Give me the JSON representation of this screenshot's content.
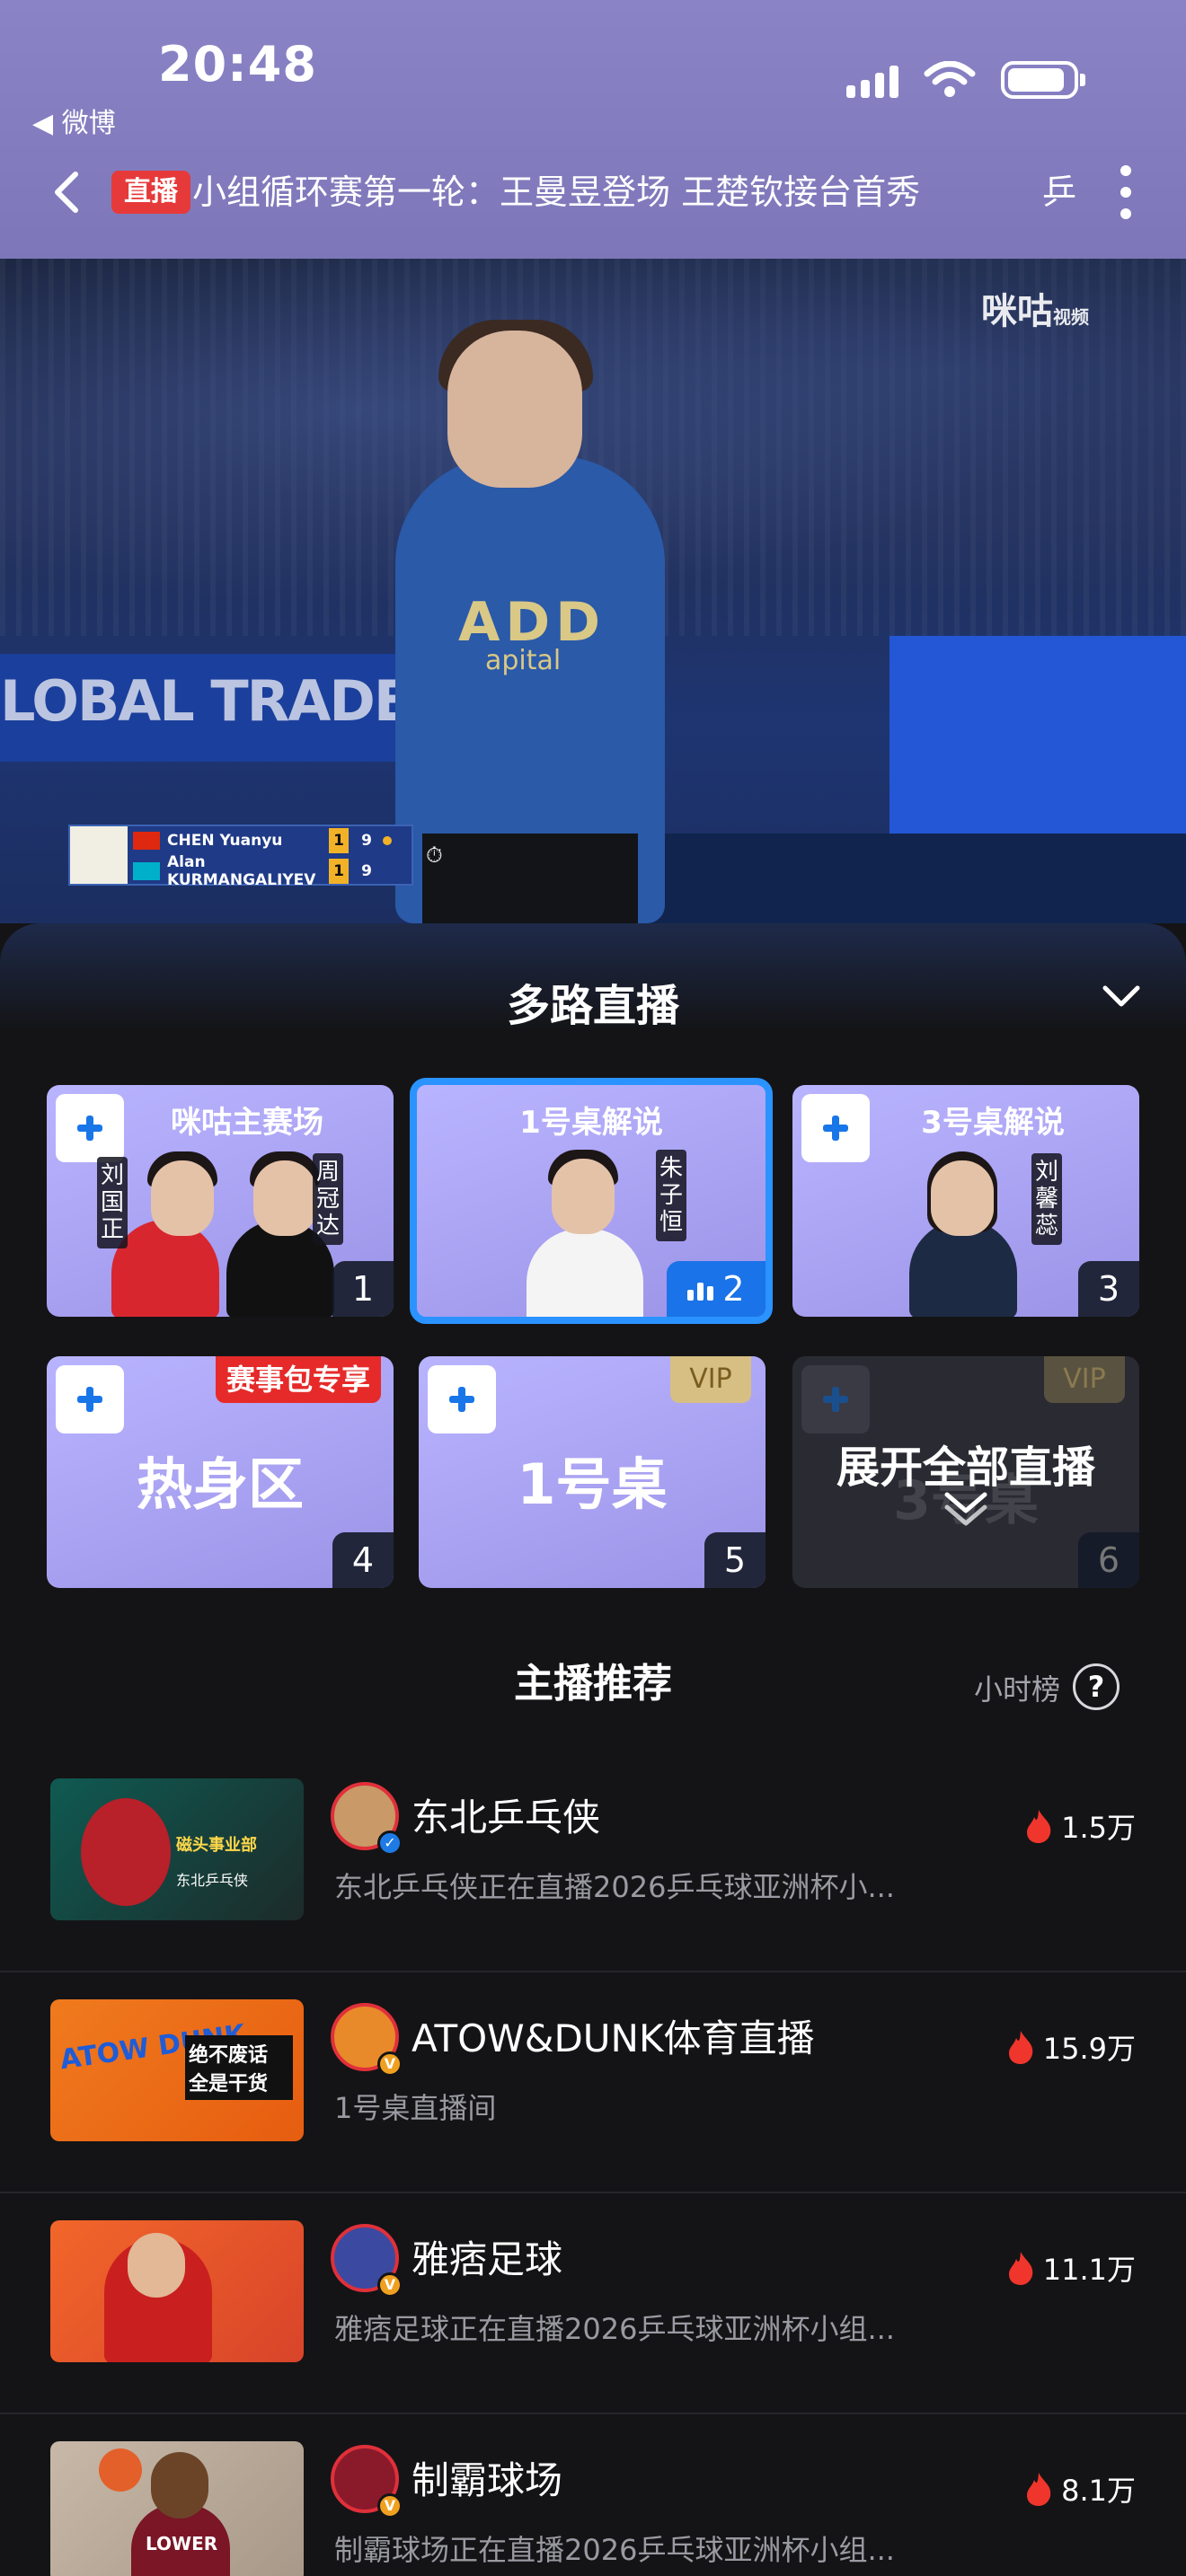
{
  "status_bar": {
    "time": "20:48",
    "back_app": "◀ 微博"
  },
  "nav": {
    "live_tag": "直播",
    "title": "小组循环赛第一轮：王曼昱登场 王楚钦接台首秀",
    "title_overflow": "乒"
  },
  "video": {
    "watermark": "咪咕",
    "watermark_sub": "视频",
    "banner_text": "LOBAL TRADE",
    "jersey_text": "ADD",
    "jersey_sub": "apital",
    "scoreboard": {
      "players": [
        {
          "name": "CHEN Yuanyu",
          "set": "1",
          "points": "9",
          "serving": true
        },
        {
          "name": "Alan KURMANGALIYEV",
          "set": "1",
          "points": "9",
          "serving": false
        }
      ],
      "timer_icon": "⏱"
    }
  },
  "multi_live": {
    "title": "多路直播",
    "cards": [
      {
        "title": "咪咕主赛场",
        "number": "1",
        "names": [
          "刘国正",
          "周冠达"
        ],
        "active": false
      },
      {
        "title": "1号桌解说",
        "number": "2",
        "names": [
          "朱子恒"
        ],
        "active": true
      },
      {
        "title": "3号桌解说",
        "number": "3",
        "names": [
          "刘馨蕊"
        ],
        "active": false
      },
      {
        "big_label": "热身区",
        "number": "4",
        "badge": "赛事包专享"
      },
      {
        "big_label": "1号桌",
        "number": "5",
        "badge": "VIP"
      },
      {
        "ghost_label": "3号桌",
        "number": "6",
        "badge": "VIP",
        "overlay": "展开全部直播"
      }
    ]
  },
  "recommend": {
    "title": "主播推荐",
    "rank_label": "小时榜",
    "help": "?",
    "items": [
      {
        "name": "东北乒乓侠",
        "desc": "东北乒乓侠正在直播2026乒乓球亚洲杯小...",
        "heat": "1.5万",
        "thumb_text": "磁头事业部",
        "thumb_sub": "东北乒乓侠",
        "badge": "✓"
      },
      {
        "name": "ATOW&DUNK体育直播",
        "desc": "1号桌直播间",
        "heat": "15.9万",
        "thumb_text": "ATOW DUNK",
        "thumb_sub": "绝不废话 全是干货",
        "badge": "V"
      },
      {
        "name": "雅痞足球",
        "desc": "雅痞足球正在直播2026乒乓球亚洲杯小组...",
        "heat": "11.1万",
        "thumb_text": "",
        "thumb_sub": "",
        "badge": "V"
      },
      {
        "name": "制霸球场",
        "desc": "制霸球场正在直播2026乒乓球亚洲杯小组...",
        "heat": "8.1万",
        "thumb_text": "LOWER",
        "thumb_sub": "",
        "badge": "V"
      }
    ]
  },
  "colors": {
    "header": "#8a84c6",
    "accent_blue": "#2a93ff",
    "live_red": "#e63a3a",
    "vip_gold": "#d7bf83",
    "panel_bg": "#141416"
  }
}
